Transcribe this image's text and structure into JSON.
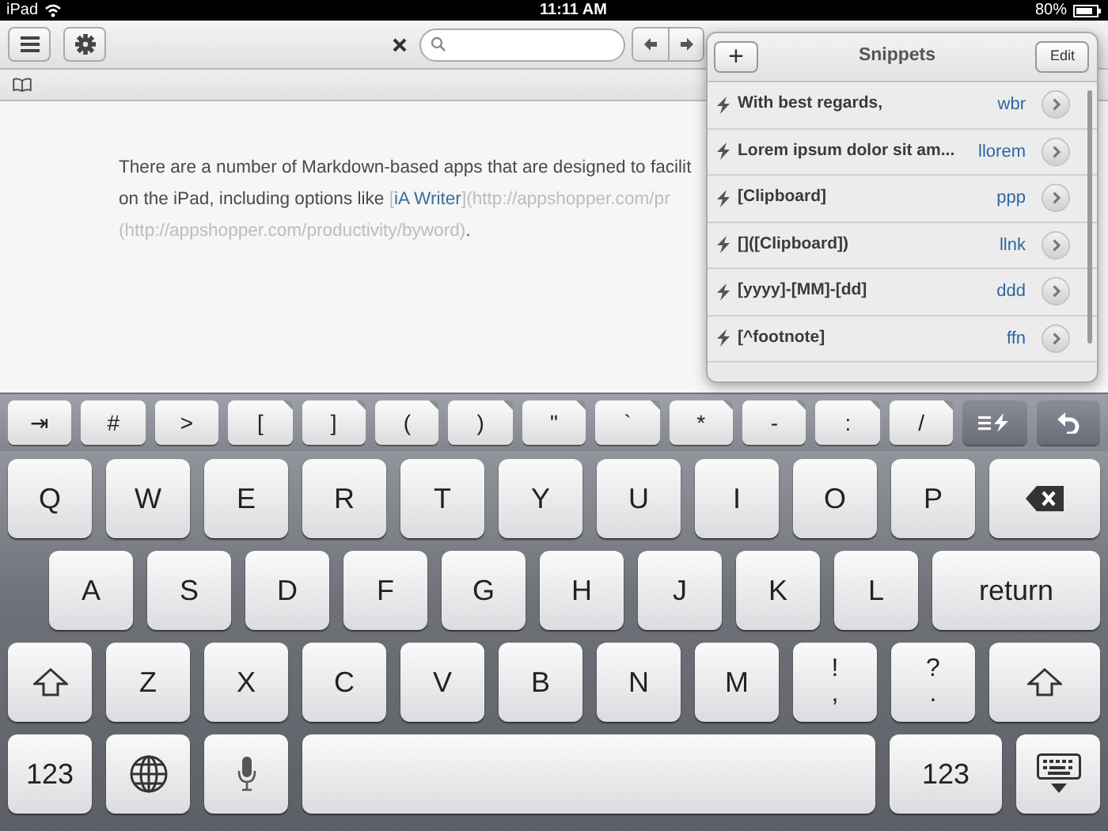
{
  "status_bar": {
    "device": "iPad",
    "time": "11:11 AM",
    "battery": "80%"
  },
  "editor": {
    "lines": [
      [
        {
          "kind": "text",
          "text": "There are a number of Markdown-based apps that are designed to facilit"
        }
      ],
      [
        {
          "kind": "text",
          "text": "on the iPad, including options like "
        },
        {
          "kind": "bracket",
          "text": "["
        },
        {
          "kind": "link",
          "text": "iA Writer"
        },
        {
          "kind": "bracket",
          "text": "]"
        },
        {
          "kind": "url",
          "text": "(http://appshopper.com/pr"
        }
      ],
      [
        {
          "kind": "url",
          "text": "(http://appshopper.com/productivity/byword)"
        },
        {
          "kind": "text",
          "text": "."
        }
      ]
    ]
  },
  "snippets": {
    "add": "+",
    "title": "Snippets",
    "edit": "Edit",
    "items": [
      {
        "text": "With best regards,",
        "abbreviation": "wbr"
      },
      {
        "text": "Lorem ipsum dolor sit am...",
        "abbreviation": "llorem"
      },
      {
        "text": "[Clipboard]",
        "abbreviation": "ppp"
      },
      {
        "text": "[]([Clipboard])",
        "abbreviation": "llnk"
      },
      {
        "text": "[yyyy]-[MM]-[dd]",
        "abbreviation": "ddd"
      },
      {
        "text": "[^footnote]",
        "abbreviation": "ffn"
      }
    ]
  },
  "extra_keys": [
    {
      "kind": "char",
      "label": "⇥",
      "alternates": false
    },
    {
      "kind": "char",
      "label": "#",
      "alternates": false
    },
    {
      "kind": "char",
      "label": ">",
      "alternates": false
    },
    {
      "kind": "char",
      "label": "[",
      "alternates": true
    },
    {
      "kind": "char",
      "label": "]",
      "alternates": true
    },
    {
      "kind": "char",
      "label": "(",
      "alternates": true
    },
    {
      "kind": "char",
      "label": ")",
      "alternates": true
    },
    {
      "kind": "char",
      "label": "\"",
      "alternates": true
    },
    {
      "kind": "char",
      "label": "`",
      "alternates": true
    },
    {
      "kind": "char",
      "label": "*",
      "alternates": true
    },
    {
      "kind": "char",
      "label": "-",
      "alternates": true
    },
    {
      "kind": "char",
      "label": ":",
      "alternates": true
    },
    {
      "kind": "char",
      "label": "/",
      "alternates": true
    },
    {
      "kind": "snippets"
    },
    {
      "kind": "undo"
    }
  ],
  "keyboard": {
    "key_rows": [
      {
        "keys": [
          {
            "kind": "char",
            "label": "Q"
          },
          {
            "kind": "char",
            "label": "W"
          },
          {
            "kind": "char",
            "label": "E"
          },
          {
            "kind": "char",
            "label": "R"
          },
          {
            "kind": "char",
            "label": "T"
          },
          {
            "kind": "char",
            "label": "Y"
          },
          {
            "kind": "char",
            "label": "U"
          },
          {
            "kind": "char",
            "label": "I"
          },
          {
            "kind": "char",
            "label": "O"
          },
          {
            "kind": "char",
            "label": "P"
          },
          {
            "kind": "backspace"
          }
        ]
      },
      {
        "keys": [
          {
            "kind": "char",
            "label": "A"
          },
          {
            "kind": "char",
            "label": "S"
          },
          {
            "kind": "char",
            "label": "D"
          },
          {
            "kind": "char",
            "label": "F"
          },
          {
            "kind": "char",
            "label": "G"
          },
          {
            "kind": "char",
            "label": "H"
          },
          {
            "kind": "char",
            "label": "J"
          },
          {
            "kind": "char",
            "label": "K"
          },
          {
            "kind": "char",
            "label": "L"
          },
          {
            "kind": "word",
            "label": "return"
          }
        ]
      },
      {
        "keys": [
          {
            "kind": "shift"
          },
          {
            "kind": "char",
            "label": "Z"
          },
          {
            "kind": "char",
            "label": "X"
          },
          {
            "kind": "char",
            "label": "C"
          },
          {
            "kind": "char",
            "label": "V"
          },
          {
            "kind": "char",
            "label": "B"
          },
          {
            "kind": "char",
            "label": "N"
          },
          {
            "kind": "char",
            "label": "M"
          },
          {
            "kind": "punct",
            "top": "!",
            "bottom": ","
          },
          {
            "kind": "punct",
            "top": "?",
            "bottom": "."
          },
          {
            "kind": "shift"
          }
        ]
      },
      {
        "keys": [
          {
            "kind": "word",
            "label": "123"
          },
          {
            "kind": "globe"
          },
          {
            "kind": "mic"
          },
          {
            "kind": "space"
          },
          {
            "kind": "word",
            "label": "123"
          },
          {
            "kind": "hide"
          }
        ]
      }
    ]
  }
}
